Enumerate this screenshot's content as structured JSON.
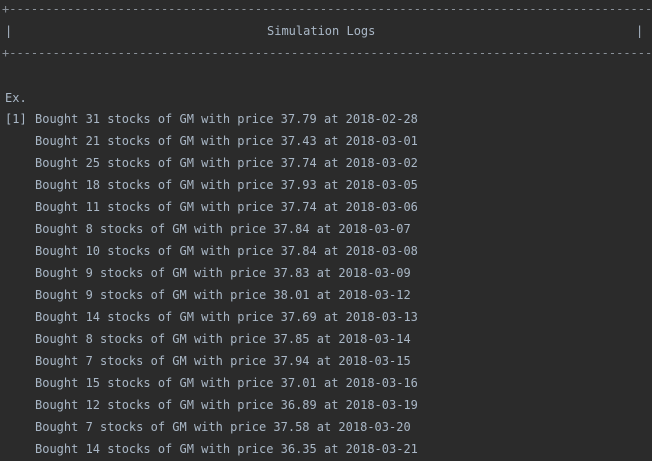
{
  "header": {
    "border_line": "+---------------------------------------------------------------------------------------------+",
    "title": "Simulation Logs",
    "side_left": "|",
    "side_right": "|"
  },
  "section": {
    "label": "Ex.",
    "run_index": "[1]"
  },
  "logs": [
    "Bought 31 stocks of GM with price 37.79 at 2018-02-28",
    "Bought 21 stocks of GM with price 37.43 at 2018-03-01",
    "Bought 25 stocks of GM with price 37.74 at 2018-03-02",
    "Bought 18 stocks of GM with price 37.93 at 2018-03-05",
    "Bought 11 stocks of GM with price 37.74 at 2018-03-06",
    "Bought 8 stocks of GM with price 37.84 at 2018-03-07",
    "Bought 10 stocks of GM with price 37.84 at 2018-03-08",
    "Bought 9 stocks of GM with price 37.83 at 2018-03-09",
    "Bought 9 stocks of GM with price 38.01 at 2018-03-12",
    "Bought 14 stocks of GM with price 37.69 at 2018-03-13",
    "Bought 8 stocks of GM with price 37.85 at 2018-03-14",
    "Bought 7 stocks of GM with price 37.94 at 2018-03-15",
    "Bought 15 stocks of GM with price 37.01 at 2018-03-16",
    "Bought 12 stocks of GM with price 36.89 at 2018-03-19",
    "Bought 7 stocks of GM with price 37.58 at 2018-03-20",
    "Bought 14 stocks of GM with price 36.35 at 2018-03-21"
  ],
  "colors": {
    "background": "#2b2b2b",
    "text": "#a9b7c6"
  }
}
